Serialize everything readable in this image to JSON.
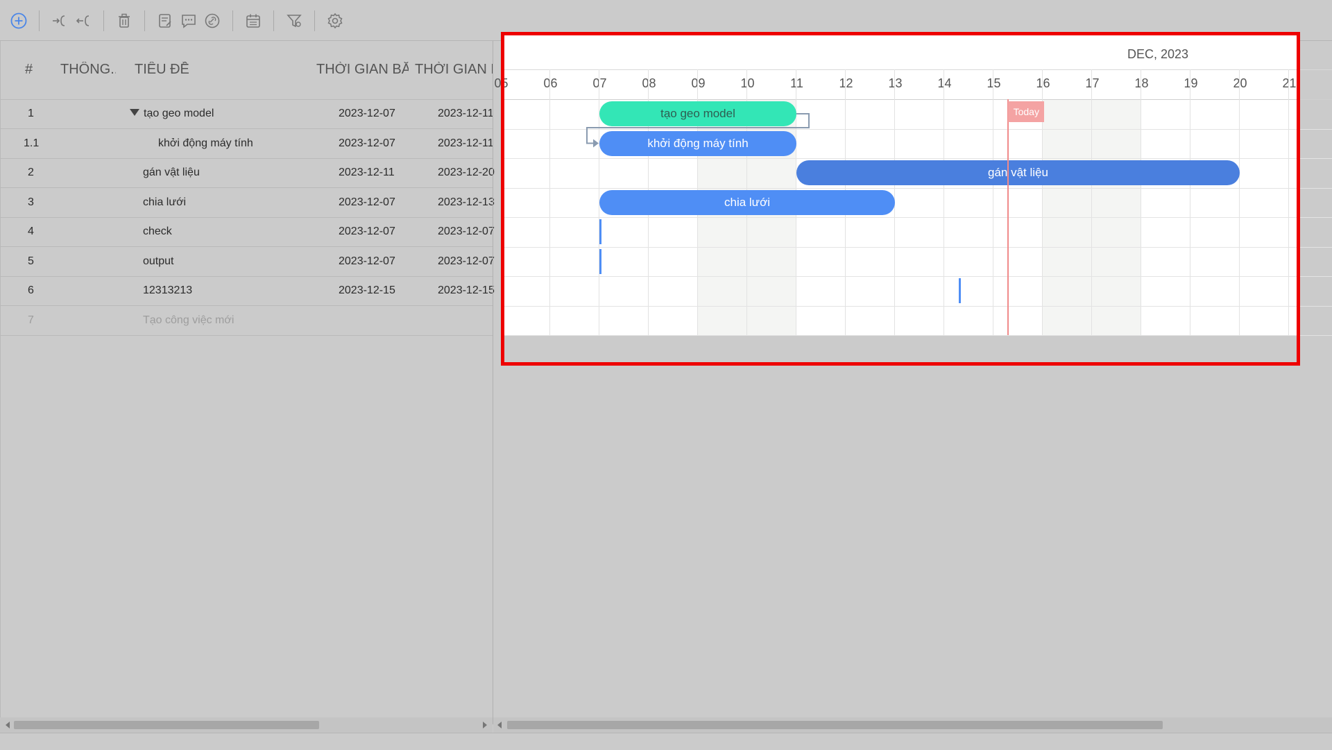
{
  "toolbar": {
    "icons": [
      "add-task-icon",
      "indent-icon",
      "outdent-icon",
      "delete-icon",
      "notes-icon",
      "comment-icon",
      "link-icon",
      "calendar-icon",
      "filter-icon",
      "settings-icon"
    ]
  },
  "grid": {
    "columns": [
      "#",
      "THÔNG...",
      "TIÊU ĐỀ",
      "THỜI GIAN BẮ...",
      "THỜI GIAN KẾ"
    ],
    "rows": [
      {
        "num": "1",
        "title": "tạo geo model",
        "start": "2023-12-07",
        "end": "2023-12-11"
      },
      {
        "num": "1.1",
        "title": "khởi động máy tính",
        "start": "2023-12-07",
        "end": "2023-12-11"
      },
      {
        "num": "2",
        "title": "gán vật liệu",
        "start": "2023-12-11",
        "end": "2023-12-20"
      },
      {
        "num": "3",
        "title": "chia lưới",
        "start": "2023-12-07",
        "end": "2023-12-13"
      },
      {
        "num": "4",
        "title": "check",
        "start": "2023-12-07",
        "end": "2023-12-07"
      },
      {
        "num": "5",
        "title": "output",
        "start": "2023-12-07",
        "end": "2023-12-07"
      },
      {
        "num": "6",
        "title": "12313213",
        "start": "2023-12-15",
        "end": "2023-12-15"
      }
    ],
    "new_row": {
      "num": "7",
      "title": "Tạo công việc mới"
    }
  },
  "chart": {
    "month": "DEC, 2023",
    "days": [
      "05",
      "06",
      "07",
      "08",
      "09",
      "10",
      "11",
      "12",
      "13",
      "14",
      "15",
      "16",
      "17",
      "18",
      "19",
      "20",
      "21"
    ],
    "weekend_days": [
      "09",
      "10",
      "16",
      "17"
    ],
    "today_label": "Today",
    "today_day": 15.3,
    "bars": [
      {
        "label": "tạo geo model",
        "start": 7,
        "end": 11,
        "kind": "project"
      },
      {
        "label": "khởi động máy tính",
        "start": 7,
        "end": 11,
        "kind": "task"
      },
      {
        "label": "gán vật liệu",
        "start": 11,
        "end": 20,
        "kind": "task2"
      },
      {
        "label": "chia lưới",
        "start": 7,
        "end": 13,
        "kind": "task"
      }
    ],
    "milestones": [
      {
        "row": 4,
        "day": 7
      },
      {
        "row": 5,
        "day": 7
      },
      {
        "row": 6,
        "day": 14.3
      }
    ]
  },
  "colors": {
    "project": "#33e6b6",
    "task": "#4f8ef5",
    "today": "#f08a8a",
    "highlight": "#ee0000"
  }
}
